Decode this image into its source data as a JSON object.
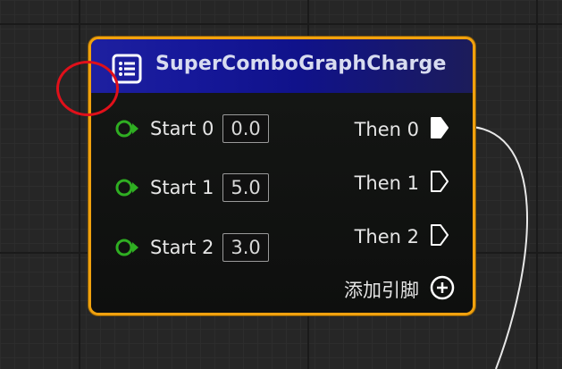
{
  "node": {
    "title": "SuperComboGraphCharge",
    "icon": "list-icon",
    "inputs": [
      {
        "label": "Start 0",
        "value": "0.0"
      },
      {
        "label": "Start 1",
        "value": "5.0"
      },
      {
        "label": "Start 2",
        "value": "3.0"
      }
    ],
    "outputs": [
      {
        "label": "Then 0",
        "connected": true
      },
      {
        "label": "Then 1",
        "connected": false
      },
      {
        "label": "Then 2",
        "connected": false
      }
    ],
    "add_pin_label": "添加引脚"
  },
  "colors": {
    "node_border": "#f0a10e",
    "header": "#1e20a0",
    "exec_input_pin": "#2fae22",
    "annotation_circle": "#e0101a"
  }
}
